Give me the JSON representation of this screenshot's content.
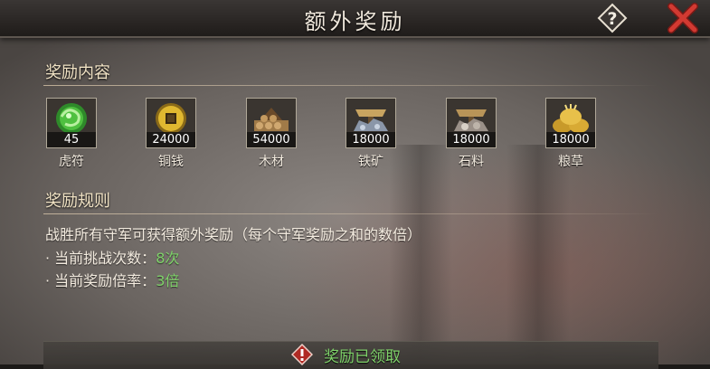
{
  "dialog": {
    "title": "额外奖励"
  },
  "reward_section": {
    "title": "奖励内容",
    "items": [
      {
        "name": "虎符",
        "count": "45",
        "icon": "tiger-tally-icon"
      },
      {
        "name": "铜钱",
        "count": "24000",
        "icon": "copper-coin-icon"
      },
      {
        "name": "木材",
        "count": "54000",
        "icon": "wood-icon"
      },
      {
        "name": "铁矿",
        "count": "18000",
        "icon": "iron-ore-icon"
      },
      {
        "name": "石料",
        "count": "18000",
        "icon": "stone-icon"
      },
      {
        "name": "粮草",
        "count": "18000",
        "icon": "grain-icon"
      }
    ]
  },
  "rules_section": {
    "title": "奖励规则",
    "description": "战胜所有守军可获得额外奖励（每个守军奖励之和的数倍）",
    "challenge_label": "· 当前挑战次数：",
    "challenge_value": "8次",
    "multiplier_label": "· 当前奖励倍率：",
    "multiplier_value": "3倍"
  },
  "status": {
    "text": "奖励已领取"
  },
  "colors": {
    "accent_green": "#7fd26a",
    "close_red": "#c0302a"
  }
}
